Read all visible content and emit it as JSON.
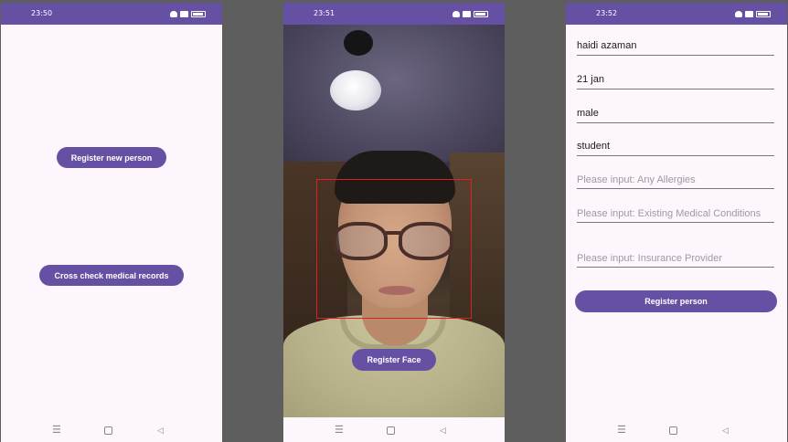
{
  "screen1": {
    "status_time": "23:50",
    "register_new_person_label": "Register new person",
    "cross_check_label": "Cross check medical records"
  },
  "screen2": {
    "status_time": "23:51",
    "register_face_label": "Register Face"
  },
  "screen3": {
    "status_time": "23:52",
    "fields": [
      {
        "value": "haidi azaman",
        "placeholder": ""
      },
      {
        "value": "21 jan",
        "placeholder": ""
      },
      {
        "value": "male",
        "placeholder": ""
      },
      {
        "value": "student",
        "placeholder": ""
      },
      {
        "value": "",
        "placeholder": "Please input: Any Allergies"
      },
      {
        "value": "",
        "placeholder": "Please input: Existing Medical Conditions"
      },
      {
        "value": "",
        "placeholder": "Please input: Insurance Provider"
      }
    ],
    "register_person_label": "Register person"
  },
  "navbar": {
    "menu_glyph": "☰",
    "back_glyph": "◁"
  },
  "colors": {
    "status_bar": "#6650a4",
    "button": "#6650a4",
    "background": "#fdf6fc",
    "face_box": "#e02020"
  },
  "icons": [
    "mute-icon",
    "record-icon",
    "battery-icon",
    "nav-menu-icon",
    "nav-home-icon",
    "nav-back-icon"
  ]
}
